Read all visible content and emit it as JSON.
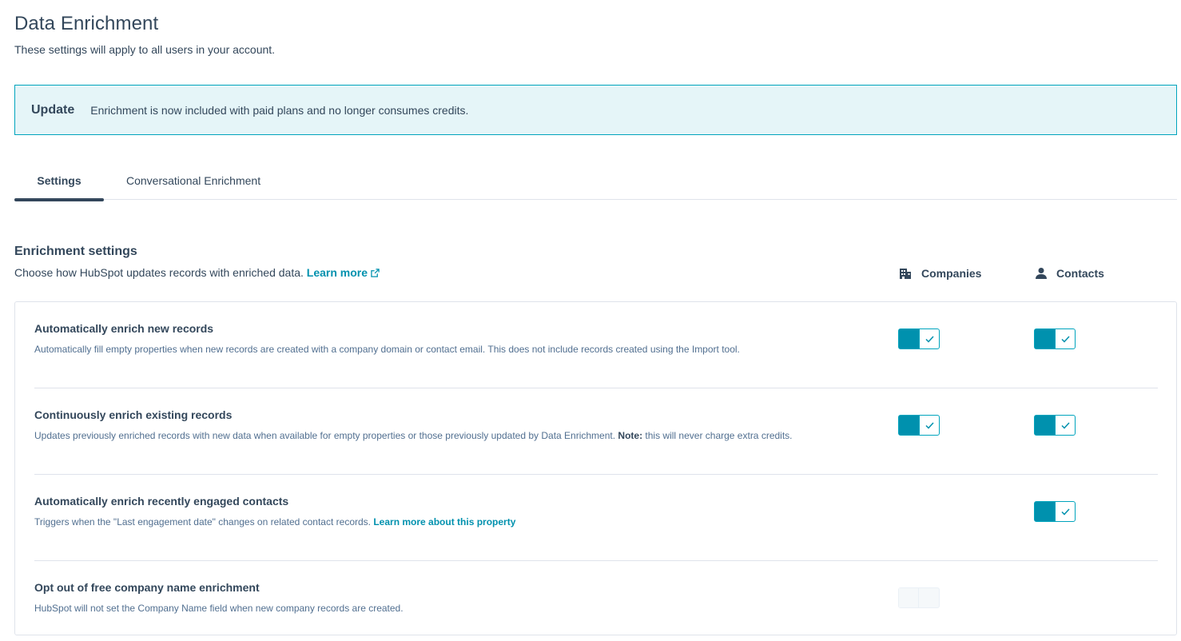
{
  "page": {
    "title": "Data Enrichment",
    "subtitle": "These settings will apply to all users in your account."
  },
  "alert": {
    "title": "Update",
    "text": "Enrichment is now included with paid plans and no longer consumes credits."
  },
  "tabs": [
    {
      "label": "Settings",
      "active": true
    },
    {
      "label": "Conversational Enrichment",
      "active": false
    }
  ],
  "section": {
    "title": "Enrichment settings",
    "description": "Choose how HubSpot updates records with enriched data.",
    "learn_more": "Learn more"
  },
  "columns": {
    "companies": {
      "label": "Companies",
      "icon": "building-icon"
    },
    "contacts": {
      "label": "Contacts",
      "icon": "person-icon"
    }
  },
  "settings": [
    {
      "title": "Automatically enrich new records",
      "description": "Automatically fill empty properties when new records are created with a company domain or contact email. This does not include records created using the Import tool.",
      "companies": "on",
      "contacts": "on"
    },
    {
      "title": "Continuously enrich existing records",
      "description": "Updates previously enriched records with new data when available for empty properties or those previously updated by Data Enrichment.",
      "note_label": "Note:",
      "note_text": "this will never charge extra credits.",
      "companies": "on",
      "contacts": "on"
    },
    {
      "title": "Automatically enrich recently engaged contacts",
      "description": "Triggers when the \"Last engagement date\" changes on related contact records.",
      "link": "Learn more about this property",
      "companies": "none",
      "contacts": "on"
    },
    {
      "title": "Opt out of free company name enrichment",
      "description": "HubSpot will not set the Company Name field when new company records are created.",
      "companies": "disabled-off",
      "contacts": "none"
    }
  ],
  "colors": {
    "accent": "#0091ae",
    "alert_bg": "#e5f5f8",
    "alert_border": "#00a4bd",
    "text": "#33475b",
    "muted_text": "#516f90",
    "divider": "#dfe3eb"
  }
}
